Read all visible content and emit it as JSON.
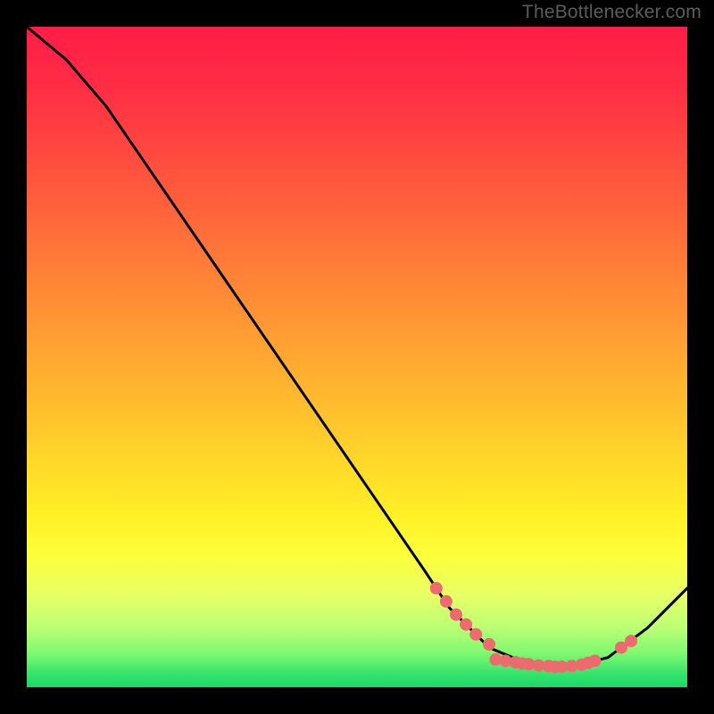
{
  "attribution": "TheBottlenecker.com",
  "chart_data": {
    "type": "line",
    "title": "",
    "xlabel": "",
    "ylabel": "",
    "xlim": [
      0,
      100
    ],
    "ylim": [
      0,
      100
    ],
    "curve": [
      {
        "x": 0,
        "y": 100
      },
      {
        "x": 6,
        "y": 95
      },
      {
        "x": 12,
        "y": 88
      },
      {
        "x": 60,
        "y": 18
      },
      {
        "x": 64,
        "y": 12
      },
      {
        "x": 70,
        "y": 6
      },
      {
        "x": 76,
        "y": 3.5
      },
      {
        "x": 82,
        "y": 3
      },
      {
        "x": 88,
        "y": 4.5
      },
      {
        "x": 94,
        "y": 9
      },
      {
        "x": 100,
        "y": 15
      }
    ],
    "markers": [
      {
        "x": 62,
        "y": 15
      },
      {
        "x": 63.5,
        "y": 13
      },
      {
        "x": 65,
        "y": 11
      },
      {
        "x": 66.5,
        "y": 9.5
      },
      {
        "x": 68,
        "y": 8
      },
      {
        "x": 70,
        "y": 6.5
      },
      {
        "x": 71,
        "y": 4.2
      },
      {
        "x": 72.5,
        "y": 4
      },
      {
        "x": 74,
        "y": 3.8
      },
      {
        "x": 75,
        "y": 3.6
      },
      {
        "x": 76,
        "y": 3.5
      },
      {
        "x": 77.5,
        "y": 3.3
      },
      {
        "x": 79,
        "y": 3.2
      },
      {
        "x": 80,
        "y": 3.1
      },
      {
        "x": 81,
        "y": 3.1
      },
      {
        "x": 82.5,
        "y": 3.2
      },
      {
        "x": 84,
        "y": 3.4
      },
      {
        "x": 85,
        "y": 3.7
      },
      {
        "x": 86,
        "y": 4.0
      },
      {
        "x": 90,
        "y": 6
      },
      {
        "x": 91.5,
        "y": 7
      }
    ],
    "marker_color": "#ed6a6f",
    "gradient_stops": [
      {
        "offset": 0,
        "color": "#ff1d47"
      },
      {
        "offset": 50,
        "color": "#ffc22c"
      },
      {
        "offset": 80,
        "color": "#fbff3a"
      },
      {
        "offset": 100,
        "color": "#1ad869"
      }
    ]
  }
}
